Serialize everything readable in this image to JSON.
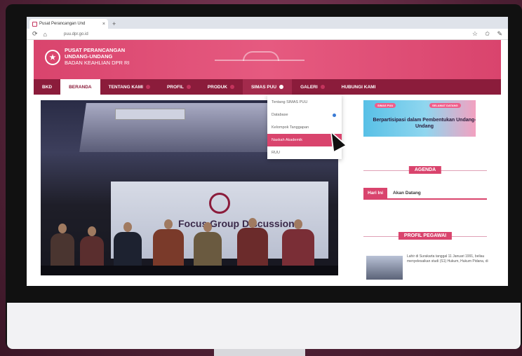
{
  "browser": {
    "tab_title": "Pusat Perancangan Und",
    "tab_close": "×",
    "new_tab": "+",
    "url": "puu.dpr.go.id"
  },
  "site": {
    "logo_line1": "PUSAT PERANCANGAN",
    "logo_line2": "UNDANG-UNDANG",
    "logo_line3": "BADAN KEAHLIAN DPR RI"
  },
  "nav": {
    "items": [
      "BKD",
      "BERANDA",
      "TENTANG KAMI",
      "PROFIL",
      "PRODUK",
      "SIMAS PUU",
      "GALERI",
      "HUBUNGI KAMI"
    ]
  },
  "dropdown": {
    "items": [
      "Tentang SIMAS PUU",
      "Database",
      "Kelompok Tanggapan",
      "Naskah Akademik",
      "RUU"
    ]
  },
  "hero": {
    "banner_text": "Focus Group Discussion"
  },
  "sidebar": {
    "banner_pill_left": "SIMAS PUU",
    "banner_pill_right": "SELAMAT DATANG",
    "banner_title": "Berpartisipasi dalam Pembentukan Undang-Undang",
    "agenda_title": "AGENDA",
    "agenda_tab_today": "Hari Ini",
    "agenda_tab_upcoming": "Akan Datang",
    "profile_title": "PROFIL PEGAWAI",
    "profile_text": "Lahir di Surakarta tanggal 11 Januari 1991, beliau menyelesaikan studi (S1) Hukum, Hukum Pidana, di"
  },
  "colors": {
    "brand_pink": "#d9446d",
    "nav_maroon": "#8b1c3b"
  }
}
